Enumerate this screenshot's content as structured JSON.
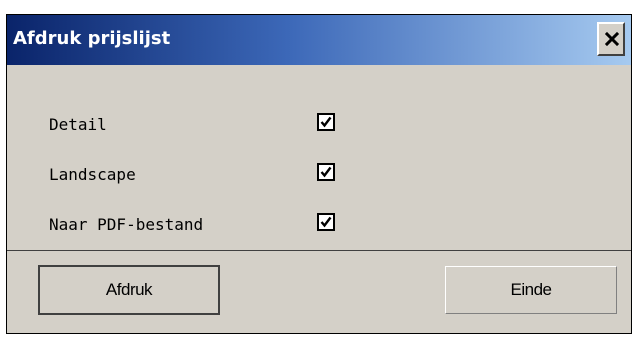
{
  "window": {
    "title": "Afdruk prijslijst",
    "close_symbol": "x",
    "title_gradient": [
      "#0a246a",
      "#a6caf0"
    ],
    "face_color": "#d4d0c8"
  },
  "options": [
    {
      "label": "Detail",
      "checked": true
    },
    {
      "label": "Landscape",
      "checked": true
    },
    {
      "label": "Naar PDF-bestand",
      "checked": true
    }
  ],
  "buttons": {
    "print_label": "Afdruk",
    "close_label": "Einde"
  },
  "icons": {
    "close": "close-icon",
    "check": "checkmark-icon"
  }
}
